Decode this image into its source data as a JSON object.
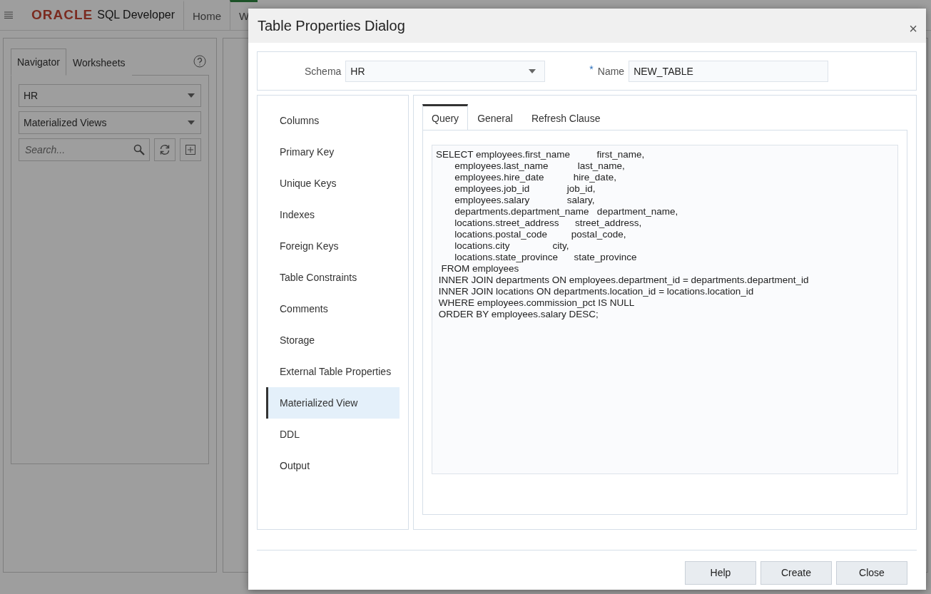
{
  "app": {
    "logo": "ORACLE",
    "product": "SQL Developer",
    "tabs": [
      {
        "label": "Home",
        "selected": false
      },
      {
        "label": "W",
        "selected": true
      }
    ]
  },
  "navigator": {
    "tabs": [
      {
        "label": "Navigator",
        "selected": true
      },
      {
        "label": "Worksheets",
        "selected": false
      }
    ],
    "schema": "HR",
    "object_type": "Materialized Views",
    "search": {
      "placeholder": "Search..."
    }
  },
  "dialog": {
    "title": "Table Properties Dialog",
    "close": "×",
    "schema_label": "Schema",
    "schema": "HR",
    "name_label": "Name",
    "required_mark": "*",
    "name": "NEW_TABLE",
    "sections": [
      {
        "label": "Columns",
        "selected": false
      },
      {
        "label": "Primary Key",
        "selected": false
      },
      {
        "label": "Unique Keys",
        "selected": false
      },
      {
        "label": "Indexes",
        "selected": false
      },
      {
        "label": "Foreign Keys",
        "selected": false
      },
      {
        "label": "Table Constraints",
        "selected": false
      },
      {
        "label": "Comments",
        "selected": false
      },
      {
        "label": "Storage",
        "selected": false
      },
      {
        "label": "External Table Properties",
        "selected": false
      },
      {
        "label": "Materialized View",
        "selected": true
      },
      {
        "label": "DDL",
        "selected": false
      },
      {
        "label": "Output",
        "selected": false
      }
    ],
    "tabs": [
      {
        "label": "Query",
        "selected": true
      },
      {
        "label": "General",
        "selected": false
      },
      {
        "label": "Refresh Clause",
        "selected": false
      }
    ],
    "query": "SELECT employees.first_name          first_name,\n       employees.last_name           last_name,\n       employees.hire_date           hire_date,\n       employees.job_id              job_id,\n       employees.salary              salary,\n       departments.department_name   department_name,\n       locations.street_address      street_address,\n       locations.postal_code         postal_code,\n       locations.city                city,\n       locations.state_province      state_province\n  FROM employees\n INNER JOIN departments ON employees.department_id = departments.department_id\n INNER JOIN locations ON departments.location_id = locations.location_id\n WHERE employees.commission_pct IS NULL\n ORDER BY employees.salary DESC;",
    "buttons": [
      "Help",
      "Create",
      "Close"
    ]
  }
}
